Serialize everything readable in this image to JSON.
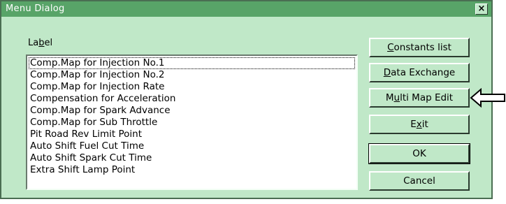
{
  "window": {
    "title": "Menu Dialog",
    "close_glyph": "×"
  },
  "list": {
    "label_pre": "La",
    "label_ul": "b",
    "label_post": "el",
    "items": [
      "Comp.Map for Injection No.1",
      "Comp.Map for Injection No.2",
      "Comp.Map for Injection Rate",
      "Compensation for Acceleration",
      "Comp.Map for Spark Advance",
      "Comp.Map for Sub Throttle",
      "Pit Road Rev Limit Point",
      "Auto Shift Fuel Cut Time",
      "Auto Shift Spark Cut Time",
      "Extra Shift Lamp Point"
    ]
  },
  "buttons": {
    "constants": {
      "pre": "",
      "ul": "C",
      "post": "onstants list"
    },
    "data_exchange": {
      "pre": "",
      "ul": "D",
      "post": "ata Exchange"
    },
    "multi_map_edit": {
      "pre": "M",
      "ul": "u",
      "post": "lti Map Edit"
    },
    "exit": {
      "pre": "E",
      "ul": "x",
      "post": "it"
    },
    "ok": {
      "label": "OK"
    },
    "cancel": {
      "label": "Cancel"
    }
  },
  "colors": {
    "dialog_bg": "#c0e8c8",
    "titlebar": "#58a468",
    "arrow": "#000000"
  },
  "annotation": {
    "arrow_icon": "left-arrow-icon"
  }
}
